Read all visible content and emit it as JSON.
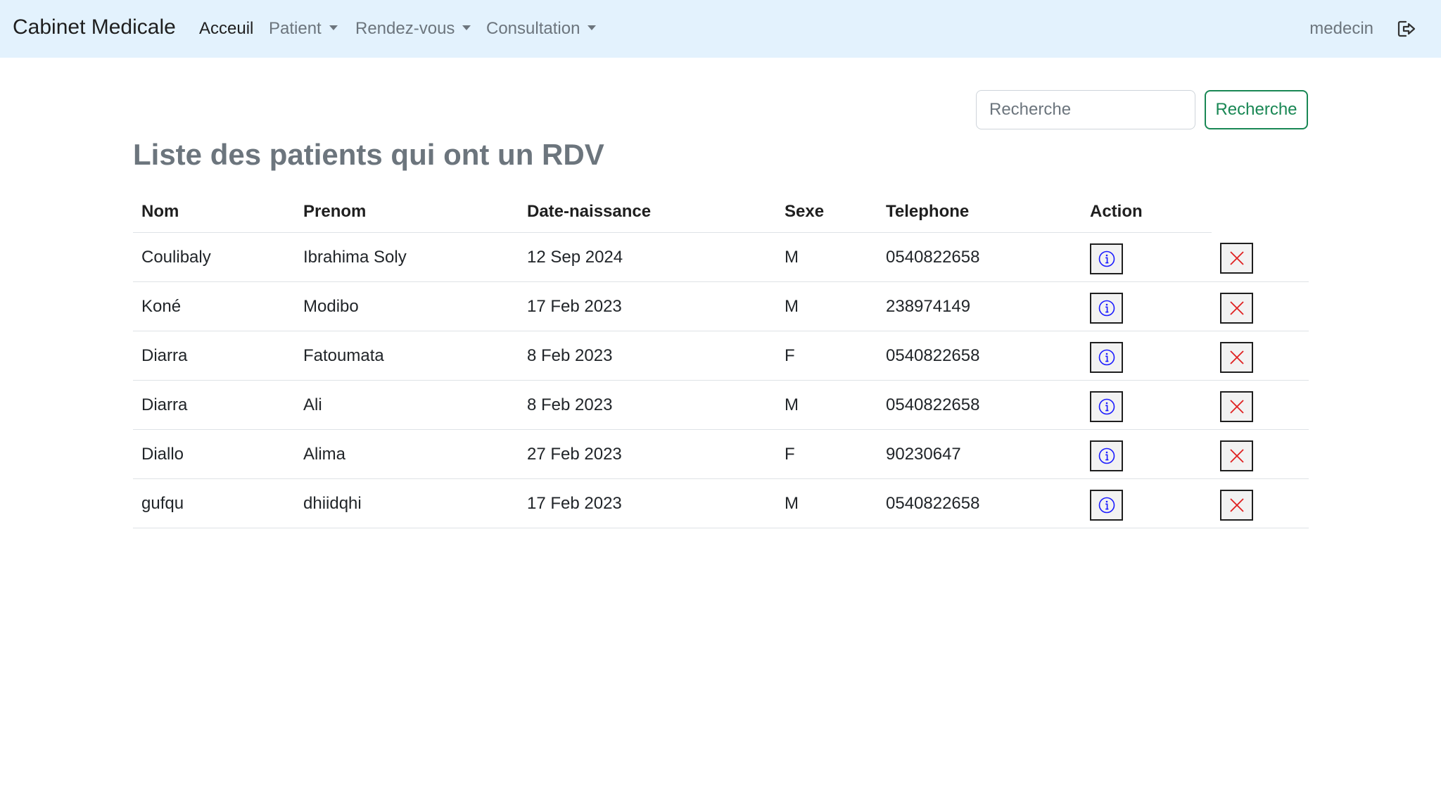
{
  "navbar": {
    "brand": "Cabinet Medicale",
    "items": [
      {
        "label": "Acceuil",
        "dropdown": false,
        "active": true
      },
      {
        "label": "Patient",
        "dropdown": true,
        "active": false
      },
      {
        "label": "Rendez-vous",
        "dropdown": true,
        "active": false
      },
      {
        "label": "Consultation",
        "dropdown": true,
        "active": false
      }
    ],
    "user": "medecin",
    "logout_icon": "logout-icon"
  },
  "search": {
    "placeholder": "Recherche",
    "value": "",
    "button_label": "Recherche"
  },
  "page_title": "Liste des patients qui ont un RDV",
  "table": {
    "headers": [
      "Nom",
      "Prenom",
      "Date-naissance",
      "Sexe",
      "Telephone",
      "Action"
    ],
    "rows": [
      {
        "nom": "Coulibaly",
        "prenom": "Ibrahima Soly",
        "date": "12 Sep 2024",
        "sexe": "M",
        "telephone": "0540822658"
      },
      {
        "nom": "Koné",
        "prenom": "Modibo",
        "date": "17 Feb 2023",
        "sexe": "M",
        "telephone": "238974149"
      },
      {
        "nom": "Diarra",
        "prenom": "Fatoumata",
        "date": "8 Feb 2023",
        "sexe": "F",
        "telephone": "0540822658"
      },
      {
        "nom": "Diarra",
        "prenom": "Ali",
        "date": "8 Feb 2023",
        "sexe": "M",
        "telephone": "0540822658"
      },
      {
        "nom": "Diallo",
        "prenom": "Alima",
        "date": "27 Feb 2023",
        "sexe": "F",
        "telephone": "90230647"
      },
      {
        "nom": "gufqu",
        "prenom": "dhiidqhi",
        "date": "17 Feb 2023",
        "sexe": "M",
        "telephone": "0540822658"
      }
    ],
    "action_icons": {
      "info": "info-circle-icon",
      "delete": "x-icon"
    }
  },
  "colors": {
    "navbar_bg": "#e3f2fd",
    "success": "#198754",
    "info_icon": "#1a1aff",
    "delete_icon": "#e02020",
    "title": "#6c757d"
  }
}
